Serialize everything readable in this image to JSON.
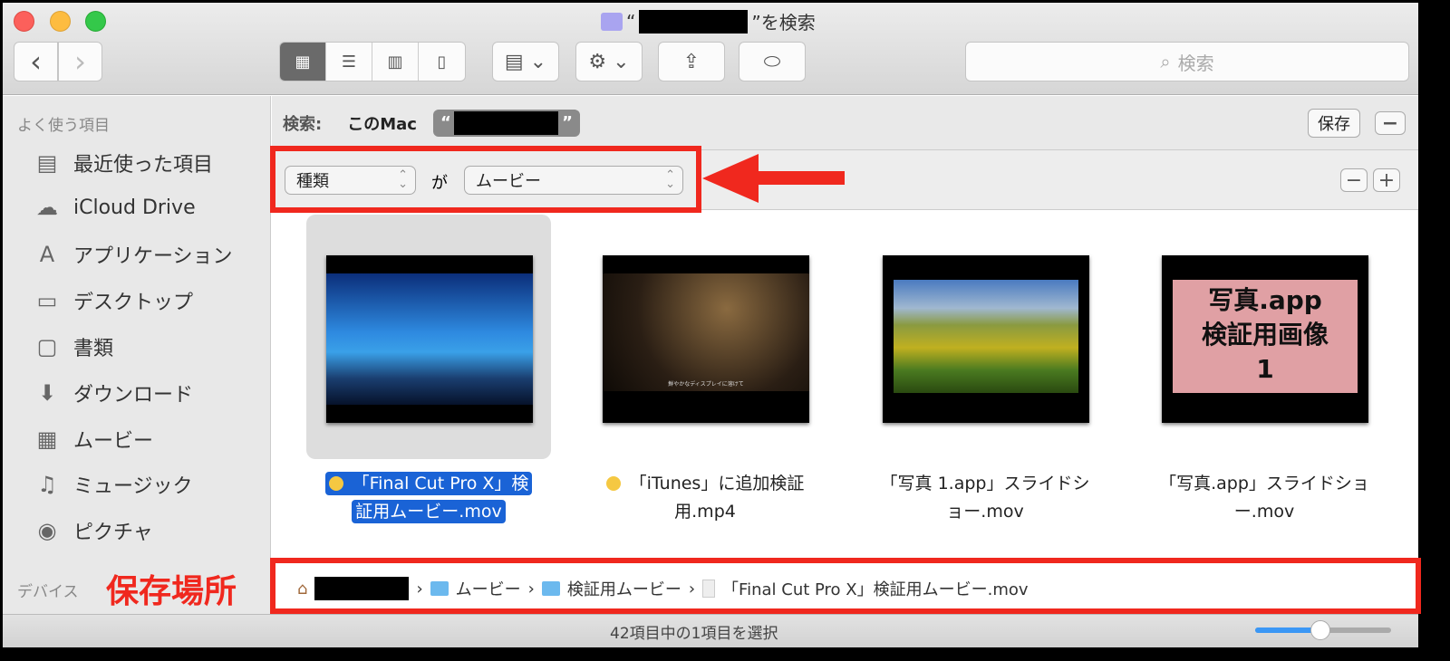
{
  "window": {
    "title_prefix": "“",
    "title_suffix": "”を検索"
  },
  "toolbar": {
    "back": "‹",
    "forward": "›",
    "view_icon": "▦",
    "list_icon": "☰",
    "column_icon": "▥",
    "coverflow_icon": "▯",
    "arrange": "▤ ⌄",
    "action": "⚙ ⌄",
    "share": "⇪",
    "tag": "⬭",
    "search_placeholder": "検索"
  },
  "sidebar": {
    "favorites_header": "よく使う項目",
    "items": [
      {
        "label": "最近使った項目",
        "icon": "▤"
      },
      {
        "label": "iCloud Drive",
        "icon": "☁"
      },
      {
        "label": "アプリケーション",
        "icon": "A"
      },
      {
        "label": "デスクトップ",
        "icon": "▭"
      },
      {
        "label": "書類",
        "icon": "▢"
      },
      {
        "label": "ダウンロード",
        "icon": "⬇"
      },
      {
        "label": "ムービー",
        "icon": "▦"
      },
      {
        "label": "ミュージック",
        "icon": "♫"
      },
      {
        "label": "ピクチャ",
        "icon": "◉"
      }
    ],
    "devices_header": "デバイス"
  },
  "scope": {
    "label": "検索:",
    "this_mac": "このMac",
    "quote_open": "“",
    "quote_close": "”",
    "save": "保存",
    "remove": "−"
  },
  "criteria": {
    "attribute": "種類",
    "connector": "が",
    "value": "ムービー",
    "remove": "−",
    "add": "+"
  },
  "files": [
    {
      "name_line1": "「Final Cut Pro X」検",
      "name_line2": "証用ムービー.mov",
      "tag": "yellow",
      "selected": true
    },
    {
      "name_line1": "「iTunes」に追加検証",
      "name_line2": "用.mp4",
      "tag": "yellow",
      "selected": false
    },
    {
      "name_line1": "「写真 1.app」スライドシ",
      "name_line2": "ョー.mov",
      "selected": false
    },
    {
      "name_line1": "「写真.app」スライドショ",
      "name_line2": "ー.mov",
      "selected": false
    }
  ],
  "thumb4_text": {
    "l1": "写真.app",
    "l2": "検証用画像",
    "l3": "1"
  },
  "thumb2_caption": "鮮やかなディスプレイに溶けて",
  "pathbar": {
    "sep": "›",
    "items": [
      "ムービー",
      "検証用ムービー",
      "「Final Cut Pro X」検証用ムービー.mov"
    ]
  },
  "status": {
    "text": "42項目中の1項目を選択",
    "zoom_fraction": 0.48
  },
  "annotations": {
    "location_label": "保存場所"
  },
  "colors": {
    "annotation": "#f0281e",
    "selection": "#1a63d6",
    "tag_yellow": "#f5c842"
  }
}
